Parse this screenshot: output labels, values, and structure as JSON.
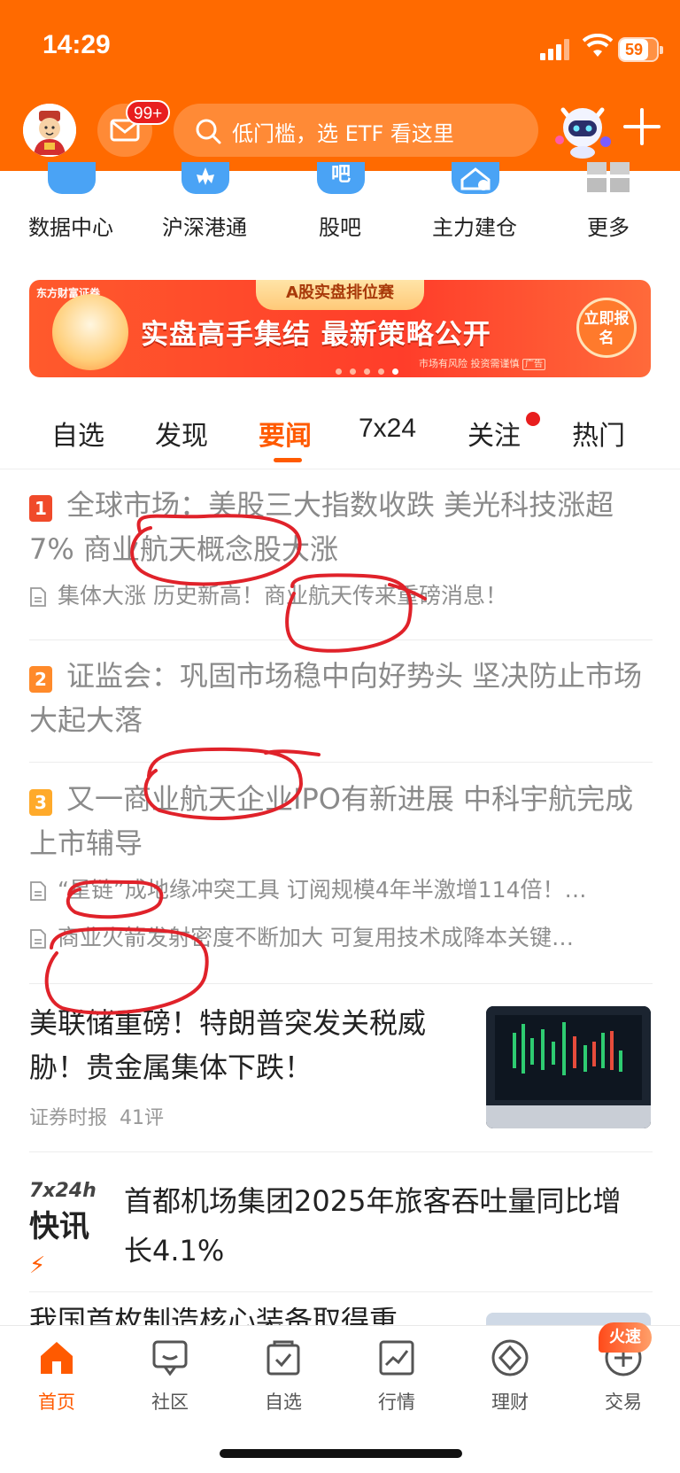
{
  "status": {
    "time": "14:29",
    "battery": "59"
  },
  "header": {
    "mail_badge": "99+",
    "search_placeholder": "低门槛，选 ETF 看这里"
  },
  "quick_links": [
    {
      "label": "数据中心",
      "icon": "data-center-icon",
      "color": "#4aa3f5"
    },
    {
      "label": "沪深港通",
      "icon": "hk-connect-icon",
      "color": "#4aa3f5"
    },
    {
      "label": "股吧",
      "icon": "stock-forum-icon",
      "color": "#4aa3f5"
    },
    {
      "label": "主力建仓",
      "icon": "main-force-icon",
      "color": "#4aa3f5"
    },
    {
      "label": "更多",
      "icon": "more-grid-icon",
      "color": "#bbbbbb"
    }
  ],
  "banner": {
    "brand": "东方财富证券",
    "tag": "A股实盘排位赛",
    "headline": "实盘高手集结 最新策略公开",
    "cta": "立即报名",
    "risk": "市场有风险 投资需谨慎",
    "ad": "广告",
    "slide_index": 5,
    "slide_count": 5
  },
  "tabs": [
    "自选",
    "发现",
    "要闻",
    "7x24",
    "关注",
    "热门"
  ],
  "active_tab": "要闻",
  "news": [
    {
      "rank": "1",
      "title": "全球市场：美股三大指数收跌 美光科技涨超7% 商业航天概念股大涨",
      "subs": [
        "集体大涨 历史新高！商业航天传来重磅消息！"
      ]
    },
    {
      "rank": "2",
      "title": "证监会：巩固市场稳中向好势头 坚决防止市场大起大落",
      "subs": []
    },
    {
      "rank": "3",
      "title": "又一商业航天企业IPO有新进展 中科宇航完成上市辅导",
      "subs": [
        "“星链”成地缘冲突工具 订阅规模4年半激增114倍！…",
        "商业火箭发射密度不断加大 可复用技术成降本关键…"
      ]
    }
  ],
  "feed": {
    "headline": "美联储重磅！特朗普突发关税威胁！贵金属集体下跌！",
    "source": "证券时报",
    "comments": "41评"
  },
  "flash": {
    "logo_top": "7x24h",
    "logo_bottom": "快讯",
    "text": "首都机场集团2025年旅客吞吐量同比增长4.1%"
  },
  "partial": {
    "text": "我国首枚制造核心装备取得重"
  },
  "nav": [
    {
      "label": "首页",
      "icon": "home-icon"
    },
    {
      "label": "社区",
      "icon": "community-icon"
    },
    {
      "label": "自选",
      "icon": "watchlist-icon"
    },
    {
      "label": "行情",
      "icon": "market-icon"
    },
    {
      "label": "理财",
      "icon": "wealth-icon"
    },
    {
      "label": "交易",
      "icon": "trade-icon"
    }
  ],
  "nav_hot_badge": "火速",
  "colors": {
    "brand": "#ff6a00",
    "accent": "#ff5a00",
    "annotation": "#e0222a"
  }
}
